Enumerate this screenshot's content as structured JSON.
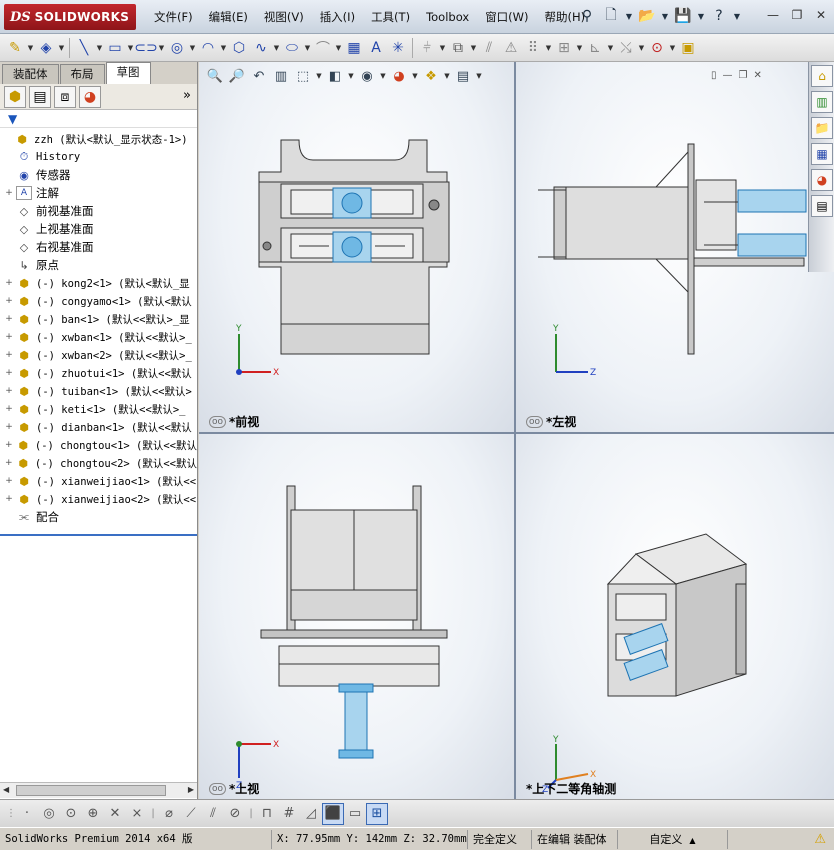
{
  "app": {
    "brand_ds": "DS",
    "brand_name": "SOLIDWORKS"
  },
  "menu": [
    "文件(F)",
    "编辑(E)",
    "视图(V)",
    "插入(I)",
    "工具(T)",
    "Toolbox",
    "窗口(W)",
    "帮助(H)"
  ],
  "quick_access": [
    "pin-icon",
    "new-document-icon",
    "open-icon",
    "save-icon",
    "print-icon",
    "help-icon"
  ],
  "window_controls": [
    "minimize",
    "restore",
    "close"
  ],
  "toolbar": {
    "icons": [
      "sketch-icon",
      "smart-dimension-icon",
      "line-icon",
      "rectangle-icon",
      "slot-icon",
      "circle-icon",
      "arc-icon",
      "polygon-icon",
      "spline-icon",
      "ellipse-icon",
      "fillet-icon",
      "plane-icon",
      "text-icon",
      "point-icon",
      "trim-icon",
      "offset-icon",
      "mirror-icon",
      "linear-pattern-icon",
      "move-entities-icon",
      "display-relations-icon",
      "repair-sketch-icon",
      "rapid-sketch-icon",
      "instant-2d-icon"
    ]
  },
  "left_panel": {
    "tabs": [
      "装配体",
      "布局",
      "草图"
    ],
    "active_tab": "草图",
    "panel_icons": [
      "feature-manager-icon",
      "property-manager-icon",
      "configuration-manager-icon",
      "display-manager-icon"
    ],
    "more_glyph": "»",
    "tree": [
      {
        "label": "zzh  (默认<默认_显示状态-1>)",
        "icon": "assembly-icon",
        "expander": "",
        "indent": 0
      },
      {
        "label": "History",
        "icon": "history-icon",
        "expander": "",
        "indent": 1
      },
      {
        "label": "传感器",
        "icon": "sensor-icon",
        "expander": "",
        "indent": 1
      },
      {
        "label": "注解",
        "icon": "annotation-icon",
        "expander": "+",
        "indent": 1
      },
      {
        "label": "前视基准面",
        "icon": "plane-icon",
        "expander": "",
        "indent": 1
      },
      {
        "label": "上视基准面",
        "icon": "plane-icon",
        "expander": "",
        "indent": 1
      },
      {
        "label": "右视基准面",
        "icon": "plane-icon",
        "expander": "",
        "indent": 1
      },
      {
        "label": "原点",
        "icon": "origin-icon",
        "expander": "",
        "indent": 1
      },
      {
        "label": "(-) kong2<1> (默认<默认_显",
        "icon": "part-icon",
        "expander": "+",
        "indent": 1
      },
      {
        "label": "(-) congyamo<1> (默认<默认",
        "icon": "part-icon",
        "expander": "+",
        "indent": 1
      },
      {
        "label": "(-) ban<1> (默认<<默认>_显",
        "icon": "part-icon",
        "expander": "+",
        "indent": 1
      },
      {
        "label": "(-) xwban<1> (默认<<默认>_",
        "icon": "part-icon",
        "expander": "+",
        "indent": 1
      },
      {
        "label": "(-) xwban<2> (默认<<默认>_",
        "icon": "part-icon",
        "expander": "+",
        "indent": 1
      },
      {
        "label": "(-) zhuotui<1> (默认<<默认",
        "icon": "part-icon",
        "expander": "+",
        "indent": 1
      },
      {
        "label": "(-) tuiban<1> (默认<<默认>",
        "icon": "part-icon",
        "expander": "+",
        "indent": 1
      },
      {
        "label": "(-) keti<1> (默认<<默认>_",
        "icon": "part-icon",
        "expander": "+",
        "indent": 1
      },
      {
        "label": "(-) dianban<1> (默认<<默认",
        "icon": "part-icon",
        "expander": "+",
        "indent": 1
      },
      {
        "label": "(-) chongtou<1> (默认<<默认",
        "icon": "part-icon",
        "expander": "+",
        "indent": 1
      },
      {
        "label": "(-) chongtou<2> (默认<<默认",
        "icon": "part-icon",
        "expander": "+",
        "indent": 1
      },
      {
        "label": "(-) xianweijiao<1> (默认<<",
        "icon": "part-icon",
        "expander": "+",
        "indent": 1
      },
      {
        "label": "(-) xianweijiao<2> (默认<<",
        "icon": "part-icon",
        "expander": "+",
        "indent": 1
      },
      {
        "label": "配合",
        "icon": "mates-icon",
        "expander": "",
        "indent": 1
      }
    ]
  },
  "viewports": [
    {
      "label": "*前视",
      "axes": [
        "Y",
        "X"
      ]
    },
    {
      "label": "*左视",
      "axes": [
        "Y",
        "Z"
      ]
    },
    {
      "label": "*上视",
      "axes": [
        "X",
        "Z"
      ]
    },
    {
      "label": "*上下二等角轴测",
      "axes": [
        "Y",
        "X",
        "Z"
      ]
    }
  ],
  "headsup_icons": [
    "zoom-to-fit-icon",
    "zoom-area-icon",
    "previous-view-icon",
    "section-view-icon",
    "view-orientation-icon",
    "display-style-icon",
    "hide-show-icon",
    "edit-appearance-icon",
    "apply-scene-icon",
    "view-settings-icon"
  ],
  "task_pane_icons": [
    "home-icon",
    "design-library-icon",
    "file-explorer-icon",
    "view-palette-icon",
    "appearances-icon",
    "custom-properties-icon"
  ],
  "bottom_toolbar_icons": [
    "point-icon",
    "circle-icon",
    "polygon-icon",
    "trim-icon",
    "extend-icon",
    "fillet-icon",
    "chamfer-icon",
    "offset-icon",
    "mirror-icon",
    "grid-icon",
    "dimension-icon",
    "shaded-icon",
    "single-view-icon",
    "four-view-icon"
  ],
  "status": {
    "version": "SolidWorks Premium 2014 x64 版",
    "coords": "X: 77.95mm Y: 142mm Z: 32.70mm",
    "definition": "完全定义",
    "mode": "在编辑 装配体",
    "units": "自定义",
    "units_caret": "▲"
  },
  "colors": {
    "accent": "#3a6fc4",
    "brand": "#b01e23",
    "cylinder": "#3aa0d8",
    "axis_y": "#2e8b2e",
    "axis_x": "#d02020",
    "axis_z": "#2040c0"
  }
}
